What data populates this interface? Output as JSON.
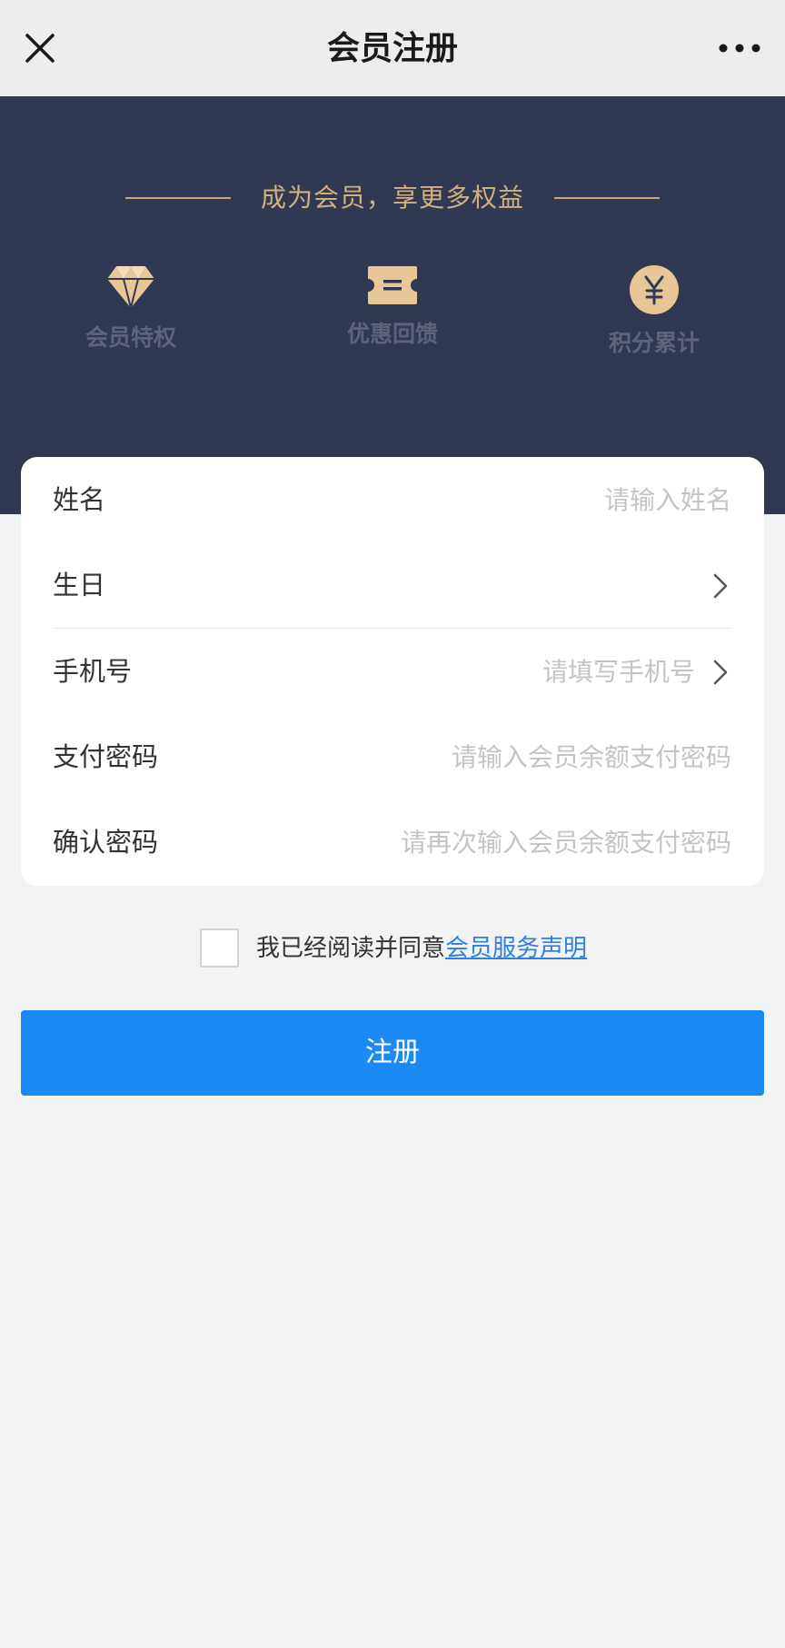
{
  "navbar": {
    "title": "会员注册",
    "close_icon": "close-icon",
    "more_icon": "more-dots-icon"
  },
  "hero": {
    "title": "成为会员，享更多权益",
    "perks": [
      {
        "label": "会员特权",
        "icon": "diamond-icon"
      },
      {
        "label": "优惠回馈",
        "icon": "coupon-ticket-icon"
      },
      {
        "label": "积分累计",
        "icon": "yuan-coin-icon"
      }
    ]
  },
  "form": {
    "fields": [
      {
        "label": "姓名",
        "placeholder": "请输入姓名"
      },
      {
        "label": "生日",
        "placeholder": ""
      },
      {
        "label": "手机号",
        "placeholder": "请填写手机号"
      },
      {
        "label": "支付密码",
        "placeholder": "请输入会员余额支付密码"
      },
      {
        "label": "确认密码",
        "placeholder": "请再次输入会员余额支付密码"
      }
    ]
  },
  "agreement": {
    "text": "我已经阅读并同意",
    "link": "会员服务声明"
  },
  "submit": {
    "label": "注册"
  },
  "colors": {
    "hero_bg": "#313952",
    "gold": "#d1b07f",
    "primary": "#1b8af4",
    "link": "#2f7fe0"
  }
}
